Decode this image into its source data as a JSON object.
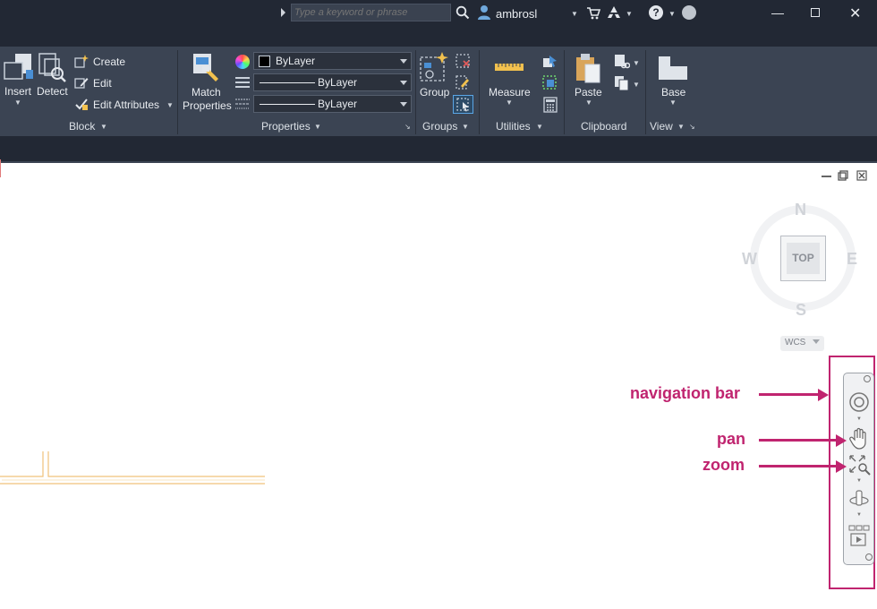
{
  "titlebar": {
    "search_placeholder": "Type a keyword or phrase",
    "username": "ambrosl"
  },
  "ribbon": {
    "block": {
      "insert_label": "Insert",
      "detect_label": "Detect",
      "create_label": "Create",
      "edit_label": "Edit",
      "edit_attributes_label": "Edit Attributes",
      "panel_title": "Block"
    },
    "properties": {
      "match_line1": "Match",
      "match_line2": "Properties",
      "color_value": "ByLayer",
      "linetype_value": "ByLayer",
      "lineweight_value": "ByLayer",
      "panel_title": "Properties"
    },
    "groups": {
      "group_label": "Group",
      "panel_title": "Groups"
    },
    "utilities": {
      "measure_label": "Measure",
      "panel_title": "Utilities"
    },
    "clipboard": {
      "paste_label": "Paste",
      "panel_title": "Clipboard"
    },
    "view": {
      "base_label": "Base",
      "panel_title": "View"
    }
  },
  "viewcube": {
    "north": "N",
    "south": "S",
    "east": "E",
    "west": "W",
    "face": "TOP",
    "wcs": "WCS"
  },
  "annotations": {
    "navigation_bar": "navigation bar",
    "pan": "pan",
    "zoom": "zoom"
  },
  "colors": {
    "annotation": "#c0246f",
    "ribbon_bg": "#3b4453",
    "titlebar_bg": "#222834"
  }
}
